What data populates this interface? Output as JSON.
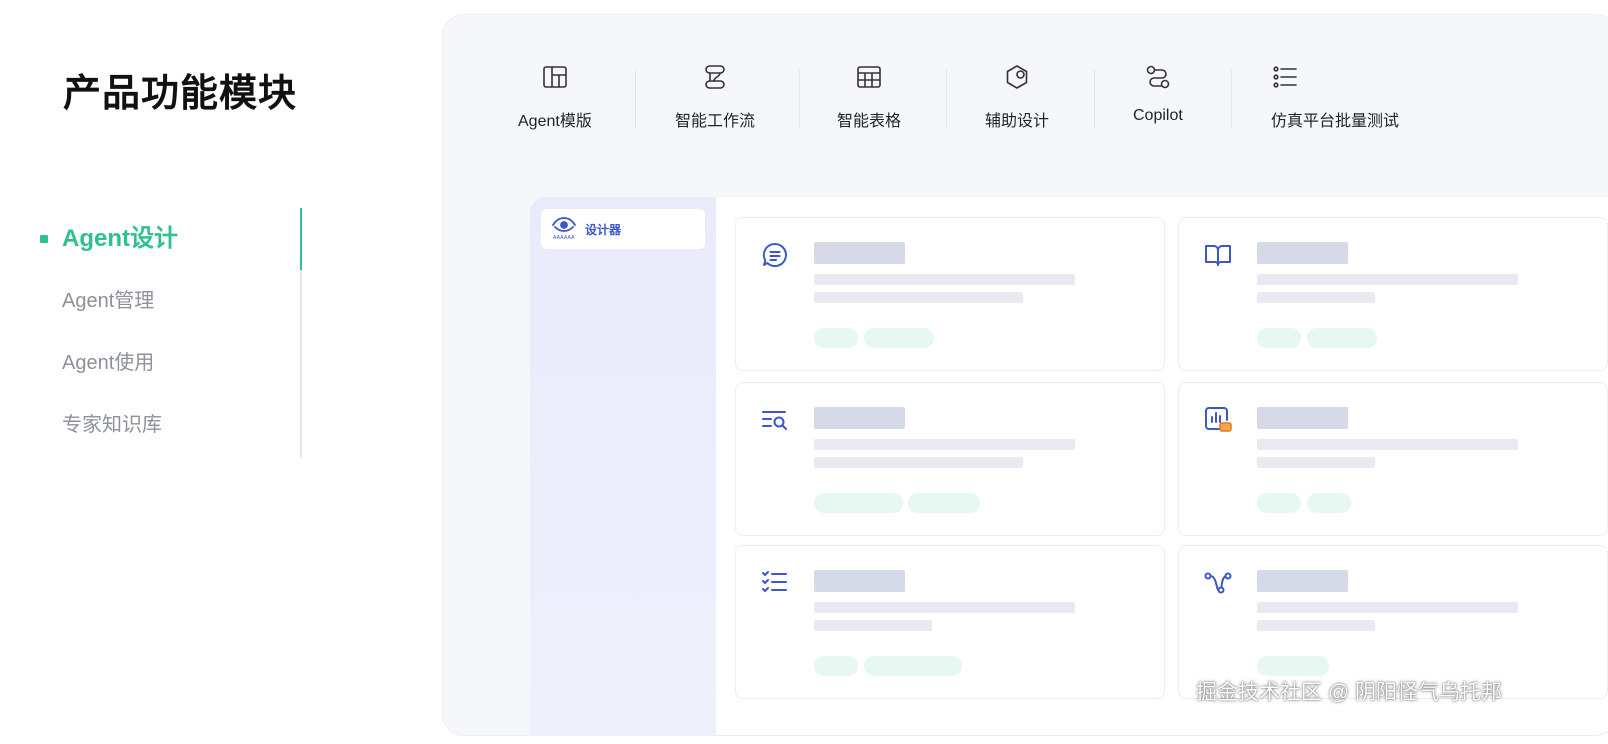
{
  "page": {
    "title": "产品功能模块"
  },
  "left_nav": {
    "items": [
      {
        "label": "Agent设计",
        "active": true
      },
      {
        "label": "Agent管理",
        "active": false
      },
      {
        "label": "Agent使用",
        "active": false
      },
      {
        "label": "专家知识库",
        "active": false
      }
    ]
  },
  "top_tabs": [
    {
      "label": "Agent模版",
      "icon": "layout-template-icon"
    },
    {
      "label": "智能工作流",
      "icon": "workflow-icon"
    },
    {
      "label": "智能表格",
      "icon": "table-grid-icon"
    },
    {
      "label": "辅助设计",
      "icon": "hexagon-design-icon"
    },
    {
      "label": "Copilot",
      "icon": "route-icon"
    },
    {
      "label": "仿真平台批量测试",
      "icon": "checklist-icon"
    }
  ],
  "app_preview": {
    "sidebar": {
      "active_item": "设计器",
      "logo_caption": "AAAAAA"
    },
    "cards": [
      {
        "icon": "message-document-icon"
      },
      {
        "icon": "open-book-icon"
      },
      {
        "icon": "list-search-icon"
      },
      {
        "icon": "gauge-badge-icon"
      },
      {
        "icon": "check-list-icon"
      },
      {
        "icon": "bezier-path-icon"
      }
    ]
  },
  "colors": {
    "accent_green": "#2fc08b",
    "accent_blue": "#3d56c9",
    "muted_text": "#8d9199"
  },
  "watermark": "掘金技术社区 @ 阴阳怪气乌托邦"
}
